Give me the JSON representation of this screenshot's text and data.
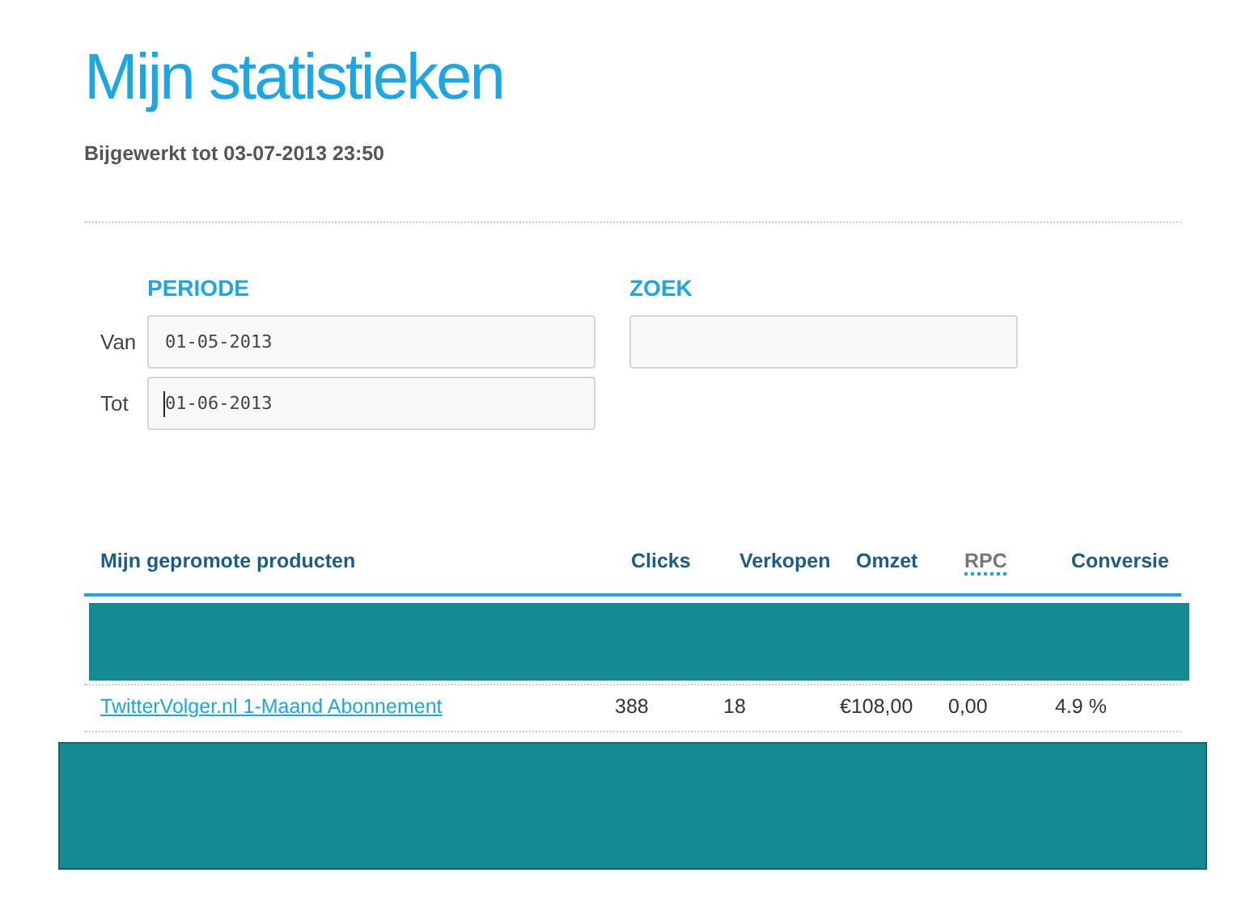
{
  "title": "Mijn statistieken",
  "updated": "Bijgewerkt tot 03-07-2013 23:50",
  "period": {
    "heading": "PERIODE",
    "fields": [
      {
        "label": "Van",
        "value": "01-05-2013",
        "focused": false
      },
      {
        "label": "Tot",
        "value": "01-06-2013",
        "focused": true
      }
    ]
  },
  "search": {
    "heading": "ZOEK"
  },
  "table": {
    "columns": [
      {
        "label": "Mijn gepromote producten",
        "kind": "plain"
      },
      {
        "label": "Clicks",
        "kind": "plain"
      },
      {
        "label": "Verkopen",
        "kind": "plain"
      },
      {
        "label": "Omzet",
        "kind": "plain"
      },
      {
        "label": "RPC",
        "kind": "abbr"
      },
      {
        "label": "Conversie",
        "kind": "plain"
      }
    ],
    "rows": [
      {
        "kind": "redacted"
      },
      {
        "kind": "data",
        "cells": [
          "TwitterVolger.nl 1-Maand Abonnement",
          "388",
          "18",
          "€108,00",
          "0,00",
          "4.9 %"
        ]
      },
      {
        "kind": "redacted-large"
      }
    ]
  }
}
